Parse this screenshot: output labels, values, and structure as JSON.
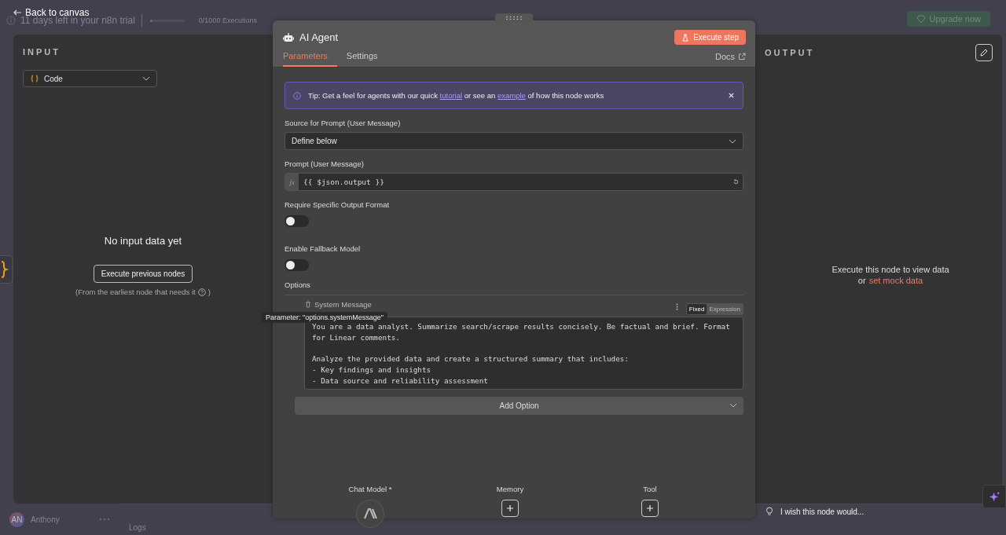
{
  "top_bar": {
    "back_label": "Back to canvas",
    "trial_text": "11 days left in your n8n trial",
    "usage": {
      "level": 0.02
    },
    "executions": "0/1000 Executions",
    "upgrade_button": "Upgrade now"
  },
  "input_panel": {
    "title": "INPUT",
    "source_select": "Code",
    "empty_title": "No input data yet",
    "execute_button": "Execute previous nodes",
    "hint_before": "(From the earliest node that needs it",
    "hint_after": ")"
  },
  "node": {
    "title": "AI Agent",
    "execute_button": "Execute step",
    "tabs": [
      {
        "label": "Parameters",
        "selected": true
      },
      {
        "label": "Settings",
        "selected": false
      }
    ],
    "docs_link": "Docs",
    "tip": [
      {
        "kind": "text",
        "text": "Tip: Get a feel for agents with our quick "
      },
      {
        "kind": "link",
        "text": "tutorial"
      },
      {
        "kind": "text",
        "text": " or see an "
      },
      {
        "kind": "link",
        "text": "example"
      },
      {
        "kind": "text",
        "text": " of how this node works"
      }
    ],
    "fields": [
      {
        "kind": "select",
        "label": "Source for Prompt (User Message)",
        "value": "Define below"
      },
      {
        "kind": "expression",
        "label": "Prompt (User Message)",
        "prefix": "fx",
        "value": "{{ $json.output }}"
      },
      {
        "kind": "toggle",
        "label": "Require Specific Output Format",
        "on": false
      },
      {
        "kind": "toggle",
        "label": "Enable Fallback Model",
        "on": false
      }
    ],
    "options": {
      "title": "Options",
      "items": [
        {
          "label": "System Message",
          "modes": [
            {
              "label": "Fixed",
              "selected": true
            },
            {
              "label": "Expression",
              "selected": false
            }
          ],
          "value": "You are a data analyst. Summarize search/scrape results concisely. Be factual and brief. Format for Linear comments.\n\nAnalyze the provided data and create a structured summary that includes:\n- Key findings and insights\n- Data source and reliability assessment"
        }
      ],
      "add_button": "Add Option"
    },
    "tooltip": "Parameter: \"options.systemMessage\"",
    "connectors": [
      {
        "label": "Chat Model *",
        "kind": "model"
      },
      {
        "label": "Memory",
        "kind": "add"
      },
      {
        "label": "Tool",
        "kind": "add"
      }
    ]
  },
  "output_panel": {
    "title": "OUTPUT",
    "message": "Execute this node to view data",
    "or": "or",
    "mock_link": "set mock data"
  },
  "feedback": "I wish this node would...",
  "user": {
    "initials": "AN",
    "name": "Anthony"
  },
  "logs": "Logs"
}
